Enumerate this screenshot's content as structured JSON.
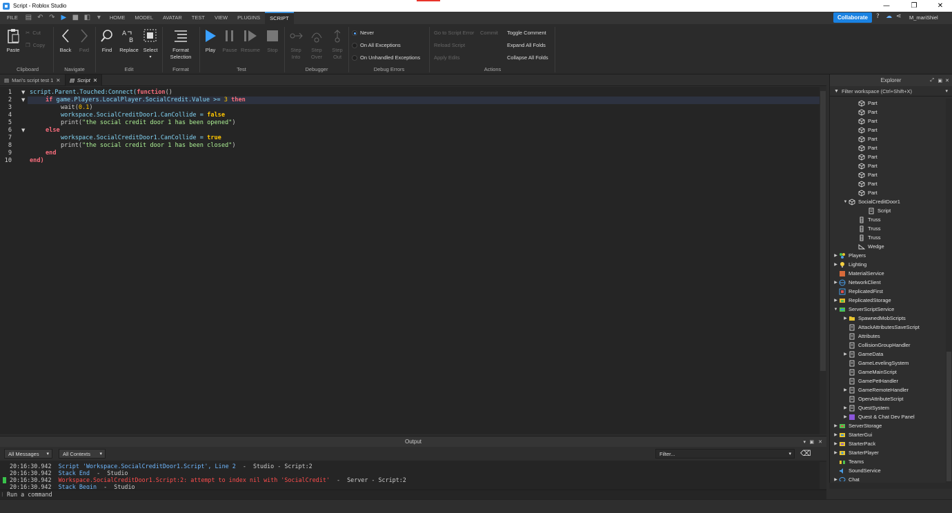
{
  "window": {
    "title": "Script - Roblox Studio",
    "minimize": "—",
    "maximize": "❐",
    "close": "✕"
  },
  "menu": {
    "file": "FILE",
    "tabs": [
      "HOME",
      "MODEL",
      "AVATAR",
      "TEST",
      "VIEW",
      "PLUGINS",
      "SCRIPT"
    ],
    "active_tab": "SCRIPT",
    "collaborate": "Collaborate",
    "user": "M_mariShiel"
  },
  "ribbon": {
    "clipboard": {
      "paste": "Paste",
      "cut": "Cut",
      "copy": "Copy",
      "label": "Clipboard"
    },
    "navigate": {
      "back": "Back",
      "fwd": "Fwd",
      "label": "Navigate"
    },
    "edit": {
      "find": "Find",
      "replace": "Replace",
      "select": "Select",
      "label": "Edit"
    },
    "format": {
      "format_selection_1": "Format",
      "format_selection_2": "Selection",
      "label": "Format"
    },
    "test": {
      "play": "Play",
      "pause": "Pause",
      "resume": "Resume",
      "stop": "Stop",
      "label": "Test"
    },
    "debugger": {
      "step_into_1": "Step",
      "step_into_2": "Into",
      "step_over_1": "Step",
      "step_over_2": "Over",
      "step_out_1": "Step",
      "step_out_2": "Out",
      "label": "Debugger"
    },
    "debug_errors": {
      "never": "Never",
      "on_all": "On All Exceptions",
      "on_unhandled": "On Unhandled Exceptions",
      "label": "Debug Errors",
      "selected": "Never"
    },
    "actions": {
      "go_to_error": "Go to Script Error",
      "commit": "Commit",
      "reload": "Reload Script",
      "apply_edits": "Apply Edits",
      "toggle_comment": "Toggle Comment",
      "expand_all": "Expand All Folds",
      "collapse_all": "Collapse All Folds",
      "label": "Actions"
    }
  },
  "doc_tabs": [
    {
      "label": "Mari's script test 1",
      "close": "✕"
    },
    {
      "label": "Script",
      "close": "✕"
    }
  ],
  "editor": {
    "line_numbers": [
      "1",
      "2",
      "3",
      "4",
      "5",
      "6",
      "7",
      "8",
      "9",
      "10"
    ],
    "lines": [
      [
        "script.Parent.Touched:Connect(",
        "function",
        "()"
      ],
      [
        "if",
        " game.Players.LocalPlayer.SocialCredit.Value >= ",
        "3",
        " ",
        "then"
      ],
      [
        "wait(",
        "0.1",
        ")"
      ],
      [
        "workspace.SocialCreditDoor1.CanCollide = ",
        "false"
      ],
      [
        "print(",
        "\"the social credit door 1 has been opened\"",
        ")"
      ],
      [
        "else"
      ],
      [
        "workspace.SocialCreditDoor1.CanCollide = ",
        "true"
      ],
      [
        "print(",
        "\"the social credit door 1 has been closed\"",
        ")"
      ],
      [
        "end"
      ],
      [
        "end)"
      ]
    ]
  },
  "explorer": {
    "title": "Explorer",
    "filter_placeholder": "Filter workspace (Ctrl+Shift+X)",
    "items": [
      {
        "label": "Part"
      },
      {
        "label": "Part"
      },
      {
        "label": "Part"
      },
      {
        "label": "Part"
      },
      {
        "label": "Part"
      },
      {
        "label": "Part"
      },
      {
        "label": "Part"
      },
      {
        "label": "Part"
      },
      {
        "label": "Part"
      },
      {
        "label": "Part"
      },
      {
        "label": "Part"
      },
      {
        "label": "SocialCreditDoor1"
      },
      {
        "label": "Script"
      },
      {
        "label": "Truss"
      },
      {
        "label": "Truss"
      },
      {
        "label": "Truss"
      },
      {
        "label": "Wedge"
      },
      {
        "label": "Players"
      },
      {
        "label": "Lighting"
      },
      {
        "label": "MaterialService"
      },
      {
        "label": "NetworkClient"
      },
      {
        "label": "ReplicatedFirst"
      },
      {
        "label": "ReplicatedStorage"
      },
      {
        "label": "ServerScriptService"
      },
      {
        "label": "SpawnedMobScripts"
      },
      {
        "label": "AttackAttributesSaveScript"
      },
      {
        "label": "Attributes"
      },
      {
        "label": "CollisionGroupHandler"
      },
      {
        "label": "GameData"
      },
      {
        "label": "GameLevelingSystem"
      },
      {
        "label": "GameMainScript"
      },
      {
        "label": "GamePetHandler"
      },
      {
        "label": "GameRemoteHandler"
      },
      {
        "label": "OpenAttributeScript"
      },
      {
        "label": "QuestSystem"
      },
      {
        "label": "Quest & Chat Dev Panel"
      },
      {
        "label": "ServerStorage"
      },
      {
        "label": "StarterGui"
      },
      {
        "label": "StarterPack"
      },
      {
        "label": "StarterPlayer"
      },
      {
        "label": "Teams"
      },
      {
        "label": "SoundService"
      },
      {
        "label": "Chat"
      }
    ]
  },
  "output": {
    "title": "Output",
    "messages_filter": "All Messages",
    "contexts_filter": "All Contexts",
    "filter_placeholder": "Filter...",
    "lines": [
      {
        "time": "20:16:30.942",
        "msg": "Script 'Workspace.SocialCreditDoor1.Script', Line 2",
        "ctx": "  -  Studio - Script:2"
      },
      {
        "time": "20:16:30.942",
        "msg": "Stack End",
        "ctx": "  -  Studio"
      },
      {
        "time": "20:16:30.942",
        "msg": "Workspace.SocialCreditDoor1.Script:2: attempt to index nil with 'SocialCredit'",
        "ctx": "  -  Server - Script:2"
      },
      {
        "time": "20:16:30.942",
        "msg": "Stack Begin",
        "ctx": "  -  Studio"
      }
    ]
  },
  "command": {
    "placeholder": "Run a command"
  }
}
